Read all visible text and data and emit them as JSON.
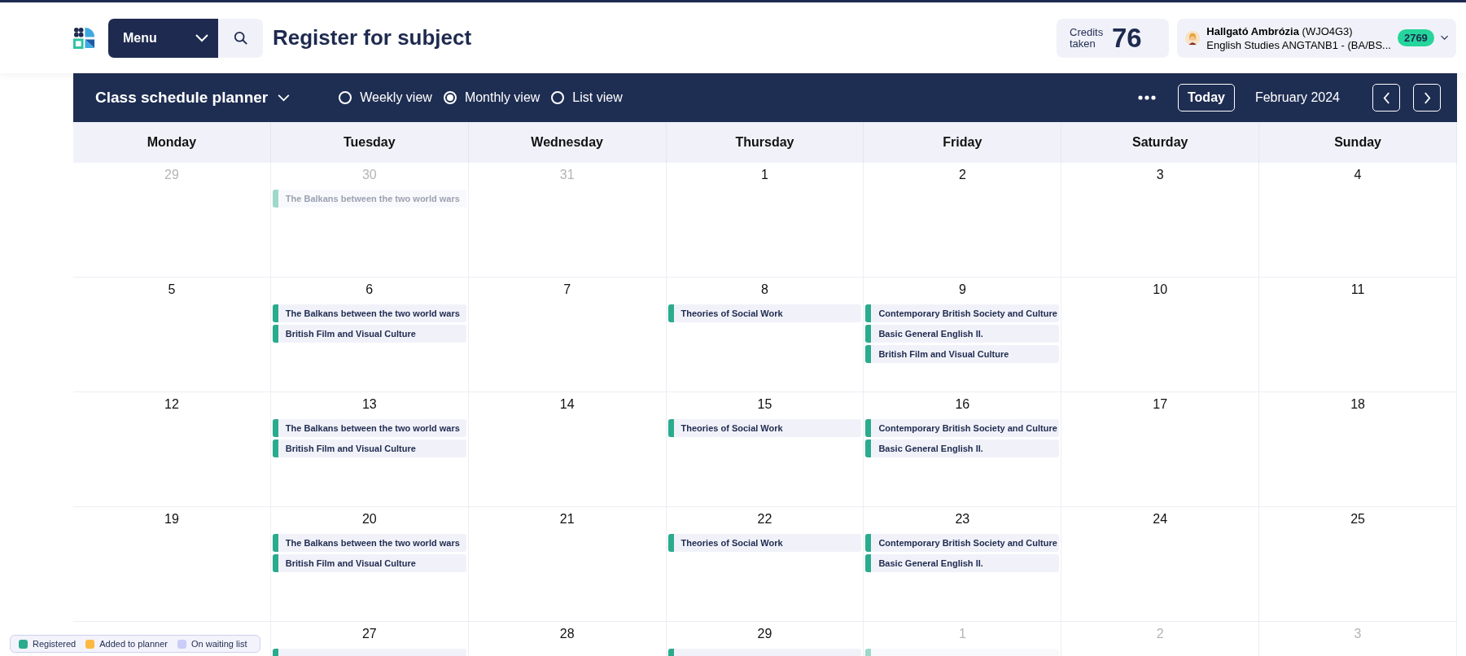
{
  "header": {
    "menu_label": "Menu",
    "title": "Register for subject",
    "credits": {
      "label": "Credits taken",
      "value": "76"
    },
    "user": {
      "name": "Hallgató Ambrózia",
      "code": "(WJO4G3)",
      "program": "English Studies ANGTANB1 - (BA/BS...",
      "badge": "2769"
    }
  },
  "toolbar": {
    "title": "Class schedule planner",
    "views": [
      {
        "label": "Weekly view",
        "selected": false
      },
      {
        "label": "Monthly view",
        "selected": true
      },
      {
        "label": "List view",
        "selected": false
      }
    ],
    "today": "Today",
    "month": "February 2024"
  },
  "weekdays": [
    "Monday",
    "Tuesday",
    "Wednesday",
    "Thursday",
    "Friday",
    "Saturday",
    "Sunday"
  ],
  "weeks": [
    [
      {
        "date": "29",
        "outside": true
      },
      {
        "date": "30",
        "outside": true,
        "events": [
          {
            "title": "The Balkans between the two world wars"
          }
        ]
      },
      {
        "date": "31",
        "outside": true
      },
      {
        "date": "1",
        "outside": false
      },
      {
        "date": "2",
        "outside": false
      },
      {
        "date": "3",
        "outside": false
      },
      {
        "date": "4",
        "outside": false
      }
    ],
    [
      {
        "date": "5",
        "outside": false
      },
      {
        "date": "6",
        "outside": false,
        "events": [
          {
            "title": "The Balkans between the two world wars"
          },
          {
            "title": "British Film and Visual Culture"
          }
        ]
      },
      {
        "date": "7",
        "outside": false
      },
      {
        "date": "8",
        "outside": false,
        "events": [
          {
            "title": "Theories of Social Work"
          }
        ]
      },
      {
        "date": "9",
        "outside": false,
        "events": [
          {
            "title": "Contemporary British Society and Culture"
          },
          {
            "title": "Basic General English II."
          },
          {
            "title": "British Film and Visual Culture"
          }
        ]
      },
      {
        "date": "10",
        "outside": false
      },
      {
        "date": "11",
        "outside": false
      }
    ],
    [
      {
        "date": "12",
        "outside": false
      },
      {
        "date": "13",
        "outside": false,
        "events": [
          {
            "title": "The Balkans between the two world wars"
          },
          {
            "title": "British Film and Visual Culture"
          }
        ]
      },
      {
        "date": "14",
        "outside": false
      },
      {
        "date": "15",
        "outside": false,
        "events": [
          {
            "title": "Theories of Social Work"
          }
        ]
      },
      {
        "date": "16",
        "outside": false,
        "events": [
          {
            "title": "Contemporary British Society and Culture"
          },
          {
            "title": "Basic General English II."
          }
        ]
      },
      {
        "date": "17",
        "outside": false
      },
      {
        "date": "18",
        "outside": false
      }
    ],
    [
      {
        "date": "19",
        "outside": false
      },
      {
        "date": "20",
        "outside": false,
        "events": [
          {
            "title": "The Balkans between the two world wars"
          },
          {
            "title": "British Film and Visual Culture"
          }
        ]
      },
      {
        "date": "21",
        "outside": false
      },
      {
        "date": "22",
        "outside": false,
        "events": [
          {
            "title": "Theories of Social Work"
          }
        ]
      },
      {
        "date": "23",
        "outside": false,
        "events": [
          {
            "title": "Contemporary British Society and Culture"
          },
          {
            "title": "Basic General English II."
          }
        ]
      },
      {
        "date": "24",
        "outside": false
      },
      {
        "date": "25",
        "outside": false
      }
    ],
    [
      {
        "kind": "covered"
      },
      {
        "date": "27",
        "outside": false,
        "events": [
          {
            "kind": "cut"
          }
        ]
      },
      {
        "date": "28",
        "outside": false
      },
      {
        "date": "29",
        "outside": false,
        "events": [
          {
            "kind": "cut"
          }
        ]
      },
      {
        "date": "1",
        "outside": true,
        "events": [
          {
            "kind": "cut"
          }
        ]
      },
      {
        "date": "2",
        "outside": true
      },
      {
        "date": "3",
        "outside": true
      }
    ]
  ],
  "legend": [
    {
      "label": "Registered",
      "color": "#2bab8e"
    },
    {
      "label": "Added to planner",
      "color": "#fbb942"
    },
    {
      "label": "On waiting list",
      "color": "#c9cdf7"
    }
  ]
}
